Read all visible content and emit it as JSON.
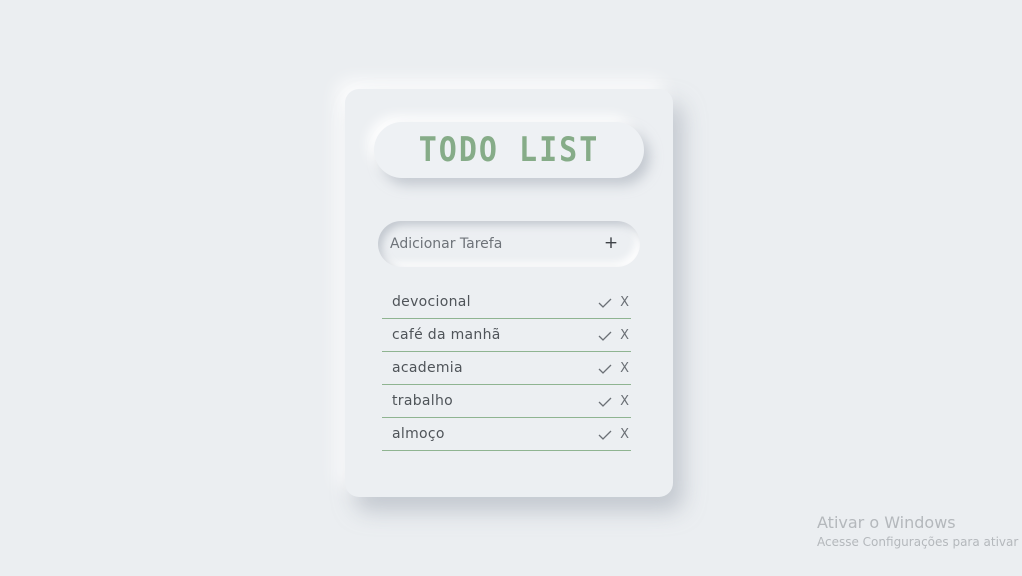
{
  "app": {
    "title": "TODO LIST",
    "accent_color": "#86ac88",
    "divider_color": "#8fb491",
    "background_color": "#ebeef1"
  },
  "add_task": {
    "placeholder": "Adicionar Tarefa",
    "value": "",
    "add_icon": "+"
  },
  "tasks": [
    {
      "label": "devocional",
      "complete_icon": "check-icon",
      "delete_label": "X"
    },
    {
      "label": "café da manhã",
      "complete_icon": "check-icon",
      "delete_label": "X"
    },
    {
      "label": "academia",
      "complete_icon": "check-icon",
      "delete_label": "X"
    },
    {
      "label": "trabalho",
      "complete_icon": "check-icon",
      "delete_label": "X"
    },
    {
      "label": "almoço",
      "complete_icon": "check-icon",
      "delete_label": "X"
    }
  ],
  "os_watermark": {
    "title": "Ativar o Windows",
    "subtitle": "Acesse Configurações para ativar"
  }
}
